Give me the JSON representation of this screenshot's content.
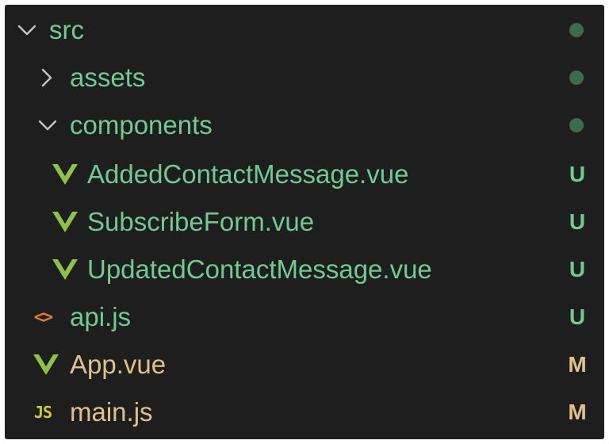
{
  "explorer": {
    "items": [
      {
        "label": "src",
        "kind": "folder",
        "expanded": true,
        "icon": "chevron-down-icon",
        "status": "dot",
        "color": "#73c991"
      },
      {
        "label": "assets",
        "kind": "folder",
        "expanded": false,
        "icon": "chevron-right-icon",
        "status": "dot",
        "color": "#73c991"
      },
      {
        "label": "components",
        "kind": "folder",
        "expanded": true,
        "icon": "chevron-down-icon",
        "status": "dot",
        "color": "#73c991"
      },
      {
        "label": "AddedContactMessage.vue",
        "kind": "file",
        "icon": "vue-icon",
        "status": "U",
        "color": "#73c991"
      },
      {
        "label": "SubscribeForm.vue",
        "kind": "file",
        "icon": "vue-icon",
        "status": "U",
        "color": "#73c991"
      },
      {
        "label": "UpdatedContactMessage.vue",
        "kind": "file",
        "icon": "vue-icon",
        "status": "U",
        "color": "#73c991"
      },
      {
        "label": "api.js",
        "kind": "file",
        "icon": "code-icon",
        "icon_text": "<>",
        "status": "U",
        "color": "#73c991"
      },
      {
        "label": "App.vue",
        "kind": "file",
        "icon": "vue-icon",
        "status": "M",
        "color": "#e2c08d"
      },
      {
        "label": "main.js",
        "kind": "file",
        "icon": "js-icon",
        "icon_text": "JS",
        "status": "M",
        "color": "#e2c08d"
      }
    ]
  },
  "colors": {
    "untracked": "#73c991",
    "modified": "#e2c08d",
    "vue": "#8dc149",
    "js": "#cbcb41",
    "code": "#e37933",
    "background": "#1e1e1e",
    "dot": "#3e6b4c"
  }
}
